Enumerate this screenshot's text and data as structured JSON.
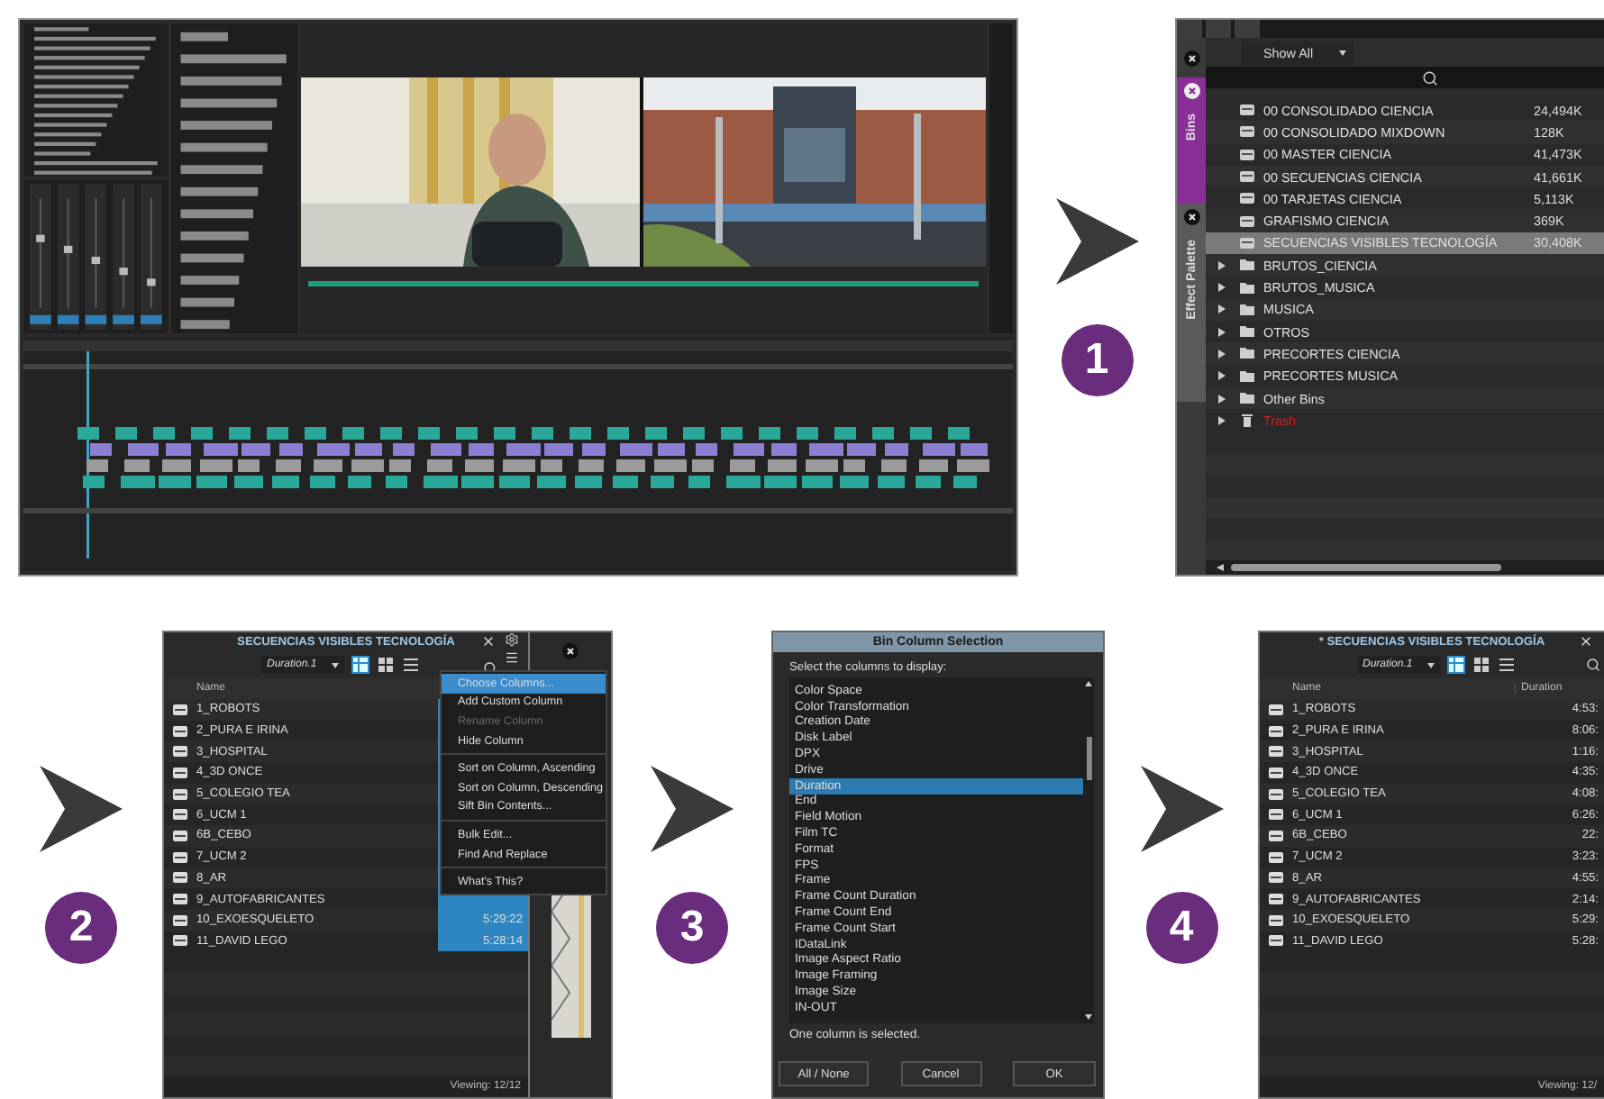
{
  "steps": [
    "1",
    "2",
    "3",
    "4"
  ],
  "bins_panel": {
    "filter": "Show All",
    "side_tabs": [
      {
        "label": "Bins",
        "selected": true
      },
      {
        "label": "Effect Palette",
        "selected": false
      }
    ],
    "items": [
      {
        "kind": "bin",
        "name": "00 CONSOLIDADO CIENCIA",
        "size": "24,494K",
        "selected": false
      },
      {
        "kind": "bin",
        "name": "00 CONSOLIDADO MIXDOWN",
        "size": "128K",
        "selected": false
      },
      {
        "kind": "bin",
        "name": "00 MASTER CIENCIA",
        "size": "41,473K",
        "selected": false
      },
      {
        "kind": "bin",
        "name": "00 SECUENCIAS CIENCIA",
        "size": "41,661K",
        "selected": false
      },
      {
        "kind": "bin",
        "name": "00 TARJETAS CIENCIA",
        "size": "5,113K",
        "selected": false
      },
      {
        "kind": "bin",
        "name": "GRAFISMO CIENCIA",
        "size": "369K",
        "selected": false
      },
      {
        "kind": "bin",
        "name": "SECUENCIAS VISIBLES TECNOLOGÍA",
        "size": "30,408K",
        "selected": true
      },
      {
        "kind": "folder",
        "name": "BRUTOS_CIENCIA",
        "selected": false
      },
      {
        "kind": "folder",
        "name": "BRUTOS_MUSICA",
        "selected": false
      },
      {
        "kind": "folder",
        "name": "MUSICA",
        "selected": false
      },
      {
        "kind": "folder",
        "name": "OTROS",
        "selected": false
      },
      {
        "kind": "folder",
        "name": "PRECORTES CIENCIA",
        "selected": false
      },
      {
        "kind": "folder",
        "name": "PRECORTES MUSICA",
        "selected": false
      },
      {
        "kind": "folder",
        "name": "Other Bins",
        "selected": false
      },
      {
        "kind": "trash",
        "name": "Trash",
        "selected": false
      }
    ]
  },
  "bin_window": {
    "title": "SECUENCIAS VISIBLES TECNOLOGÍA",
    "view": "Duration.1",
    "column": "Name",
    "clips": [
      {
        "name": "1_ROBOTS"
      },
      {
        "name": "2_PURA E IRINA"
      },
      {
        "name": "3_HOSPITAL"
      },
      {
        "name": "4_3D ONCE"
      },
      {
        "name": "5_COLEGIO TEA"
      },
      {
        "name": "6_UCM 1"
      },
      {
        "name": "6B_CEBO"
      },
      {
        "name": "7_UCM 2"
      },
      {
        "name": "8_AR"
      },
      {
        "name": "9_AUTOFABRICANTES"
      },
      {
        "name": "10_EXOESQUELETO",
        "duration": "5:29:22"
      },
      {
        "name": "11_DAVID LEGO",
        "duration": "5:28:14"
      }
    ],
    "footer": "Viewing: 12/12",
    "menu": [
      [
        {
          "label": "Choose Columns...",
          "selected": true,
          "disabled": false
        },
        {
          "label": "Add Custom Column",
          "selected": false,
          "disabled": false
        },
        {
          "label": "Rename Column",
          "selected": false,
          "disabled": true
        },
        {
          "label": "Hide Column",
          "selected": false,
          "disabled": false
        }
      ],
      [
        {
          "label": "Sort on Column, Ascending",
          "selected": false,
          "disabled": false
        },
        {
          "label": "Sort on Column, Descending",
          "selected": false,
          "disabled": false
        },
        {
          "label": "Sift Bin Contents...",
          "selected": false,
          "disabled": false
        }
      ],
      [
        {
          "label": "Bulk Edit...",
          "selected": false,
          "disabled": false
        },
        {
          "label": "Find And Replace",
          "selected": false,
          "disabled": false
        }
      ],
      [
        {
          "label": "What's This?",
          "selected": false,
          "disabled": false
        }
      ]
    ]
  },
  "column_dialog": {
    "title": "Bin Column Selection",
    "prompt": "Select the columns to display:",
    "options": [
      {
        "label": "Color Space",
        "selected": false
      },
      {
        "label": "Color Transformation",
        "selected": false
      },
      {
        "label": "Creation Date",
        "selected": false
      },
      {
        "label": "Disk Label",
        "selected": false
      },
      {
        "label": "DPX",
        "selected": false
      },
      {
        "label": "Drive",
        "selected": false
      },
      {
        "label": "Duration",
        "selected": true
      },
      {
        "label": "End",
        "selected": false
      },
      {
        "label": "Field Motion",
        "selected": false
      },
      {
        "label": "Film TC",
        "selected": false
      },
      {
        "label": "Format",
        "selected": false
      },
      {
        "label": "FPS",
        "selected": false
      },
      {
        "label": "Frame",
        "selected": false
      },
      {
        "label": "Frame Count Duration",
        "selected": false
      },
      {
        "label": "Frame Count End",
        "selected": false
      },
      {
        "label": "Frame Count Start",
        "selected": false
      },
      {
        "label": "IDataLink",
        "selected": false
      },
      {
        "label": "Image Aspect Ratio",
        "selected": false
      },
      {
        "label": "Image Framing",
        "selected": false
      },
      {
        "label": "Image Size",
        "selected": false
      },
      {
        "label": "IN-OUT",
        "selected": false
      }
    ],
    "status": "One column is selected.",
    "buttons": [
      "All / None",
      "Cancel",
      "OK"
    ]
  },
  "result_window": {
    "title": "* SECUENCIAS VISIBLES TECNOLOGÍA",
    "view": "Duration.1",
    "columns": [
      "Name",
      "Duration"
    ],
    "clips": [
      {
        "name": "1_ROBOTS",
        "duration": "4:53:"
      },
      {
        "name": "2_PURA E IRINA",
        "duration": "8:06:"
      },
      {
        "name": "3_HOSPITAL",
        "duration": "1:16:"
      },
      {
        "name": "4_3D ONCE",
        "duration": "4:35:"
      },
      {
        "name": "5_COLEGIO TEA",
        "duration": "4:08:"
      },
      {
        "name": "6_UCM 1",
        "duration": "6:26:"
      },
      {
        "name": "6B_CEBO",
        "duration": "22:"
      },
      {
        "name": "7_UCM 2",
        "duration": "3:23:"
      },
      {
        "name": "8_AR",
        "duration": "4:55:"
      },
      {
        "name": "9_AUTOFABRICANTES",
        "duration": "2:14:"
      },
      {
        "name": "10_EXOESQUELETO",
        "duration": "5:29:"
      },
      {
        "name": "11_DAVID LEGO",
        "duration": "5:28:"
      }
    ],
    "footer": "Viewing: 12/"
  }
}
